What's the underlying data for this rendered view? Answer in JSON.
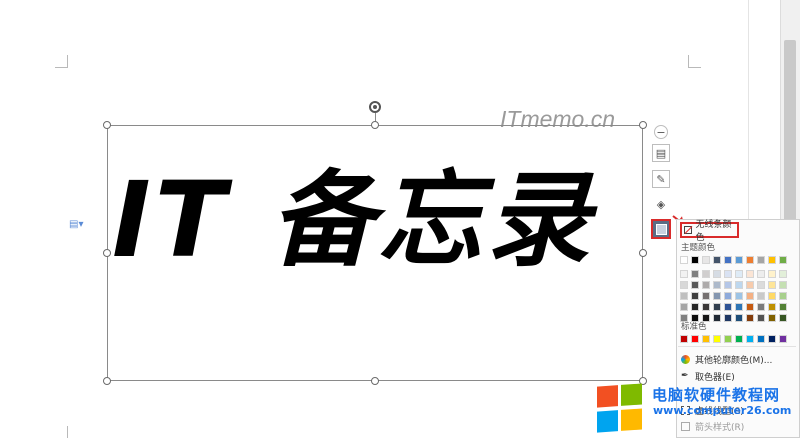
{
  "watermark": "ITmemo.cn",
  "textbox": {
    "text": "IT 备忘录"
  },
  "dropdown": {
    "no_line_label": "无线条颜色",
    "theme_label": "主题颜色",
    "standard_label": "标准色",
    "theme_colors_top": [
      "#ffffff",
      "#000000",
      "#e7e6e6",
      "#44546a",
      "#4472c4",
      "#5b9bd5",
      "#ed7d31",
      "#a5a5a5",
      "#ffc000",
      "#70ad47"
    ],
    "theme_shades": [
      [
        "#f2f2f2",
        "#7f7f7f",
        "#d0cece",
        "#d6dce4",
        "#d9e2f3",
        "#deebf6",
        "#fbe5d5",
        "#ededed",
        "#fff2cc",
        "#e2efd9"
      ],
      [
        "#d8d8d8",
        "#595959",
        "#aeabab",
        "#adb9ca",
        "#b4c6e7",
        "#bdd7ee",
        "#f7cbac",
        "#dbdbdb",
        "#fee599",
        "#c5e0b3"
      ],
      [
        "#bfbfbf",
        "#3f3f3f",
        "#757070",
        "#8496b0",
        "#8eaadb",
        "#9cc3e5",
        "#f4b083",
        "#c9c9c9",
        "#ffd965",
        "#a8d08d"
      ],
      [
        "#a5a5a5",
        "#262626",
        "#3a3838",
        "#323f4f",
        "#2f5496",
        "#2e75b5",
        "#c55a11",
        "#7b7b7b",
        "#bf9000",
        "#538135"
      ],
      [
        "#7f7f7f",
        "#0c0c0c",
        "#171616",
        "#222a35",
        "#1f3864",
        "#1e4e79",
        "#833c0b",
        "#525252",
        "#7f6000",
        "#375623"
      ]
    ],
    "standard_colors": [
      "#c00000",
      "#ff0000",
      "#ffc000",
      "#ffff00",
      "#92d050",
      "#00b050",
      "#00b0f0",
      "#0070c0",
      "#002060",
      "#7030a0"
    ],
    "more_colors_label": "其他轮廓颜色(M)...",
    "eyedropper_label": "取色器(E)",
    "dash_label": "虚线线型(S)",
    "arrow_label": "箭头样式(R)"
  },
  "brand": {
    "name": "电脑软硬件教程网",
    "url": "www.computer26.com",
    "logo_colors": [
      "#f25022",
      "#7fba00",
      "#00a4ef",
      "#ffb900"
    ]
  }
}
